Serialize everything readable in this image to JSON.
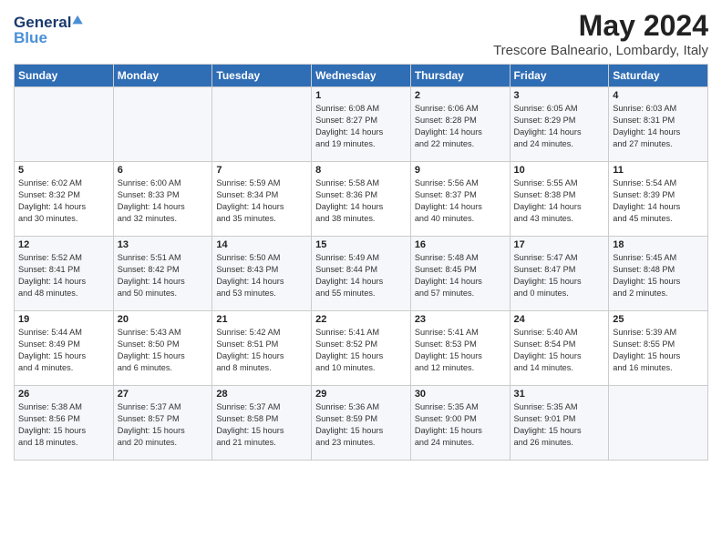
{
  "header": {
    "logo_general": "General",
    "logo_blue": "Blue",
    "title": "May 2024",
    "subtitle": "Trescore Balneario, Lombardy, Italy"
  },
  "calendar": {
    "days_of_week": [
      "Sunday",
      "Monday",
      "Tuesday",
      "Wednesday",
      "Thursday",
      "Friday",
      "Saturday"
    ],
    "weeks": [
      [
        {
          "day": "",
          "info": ""
        },
        {
          "day": "",
          "info": ""
        },
        {
          "day": "",
          "info": ""
        },
        {
          "day": "1",
          "info": "Sunrise: 6:08 AM\nSunset: 8:27 PM\nDaylight: 14 hours\nand 19 minutes."
        },
        {
          "day": "2",
          "info": "Sunrise: 6:06 AM\nSunset: 8:28 PM\nDaylight: 14 hours\nand 22 minutes."
        },
        {
          "day": "3",
          "info": "Sunrise: 6:05 AM\nSunset: 8:29 PM\nDaylight: 14 hours\nand 24 minutes."
        },
        {
          "day": "4",
          "info": "Sunrise: 6:03 AM\nSunset: 8:31 PM\nDaylight: 14 hours\nand 27 minutes."
        }
      ],
      [
        {
          "day": "5",
          "info": "Sunrise: 6:02 AM\nSunset: 8:32 PM\nDaylight: 14 hours\nand 30 minutes."
        },
        {
          "day": "6",
          "info": "Sunrise: 6:00 AM\nSunset: 8:33 PM\nDaylight: 14 hours\nand 32 minutes."
        },
        {
          "day": "7",
          "info": "Sunrise: 5:59 AM\nSunset: 8:34 PM\nDaylight: 14 hours\nand 35 minutes."
        },
        {
          "day": "8",
          "info": "Sunrise: 5:58 AM\nSunset: 8:36 PM\nDaylight: 14 hours\nand 38 minutes."
        },
        {
          "day": "9",
          "info": "Sunrise: 5:56 AM\nSunset: 8:37 PM\nDaylight: 14 hours\nand 40 minutes."
        },
        {
          "day": "10",
          "info": "Sunrise: 5:55 AM\nSunset: 8:38 PM\nDaylight: 14 hours\nand 43 minutes."
        },
        {
          "day": "11",
          "info": "Sunrise: 5:54 AM\nSunset: 8:39 PM\nDaylight: 14 hours\nand 45 minutes."
        }
      ],
      [
        {
          "day": "12",
          "info": "Sunrise: 5:52 AM\nSunset: 8:41 PM\nDaylight: 14 hours\nand 48 minutes."
        },
        {
          "day": "13",
          "info": "Sunrise: 5:51 AM\nSunset: 8:42 PM\nDaylight: 14 hours\nand 50 minutes."
        },
        {
          "day": "14",
          "info": "Sunrise: 5:50 AM\nSunset: 8:43 PM\nDaylight: 14 hours\nand 53 minutes."
        },
        {
          "day": "15",
          "info": "Sunrise: 5:49 AM\nSunset: 8:44 PM\nDaylight: 14 hours\nand 55 minutes."
        },
        {
          "day": "16",
          "info": "Sunrise: 5:48 AM\nSunset: 8:45 PM\nDaylight: 14 hours\nand 57 minutes."
        },
        {
          "day": "17",
          "info": "Sunrise: 5:47 AM\nSunset: 8:47 PM\nDaylight: 15 hours\nand 0 minutes."
        },
        {
          "day": "18",
          "info": "Sunrise: 5:45 AM\nSunset: 8:48 PM\nDaylight: 15 hours\nand 2 minutes."
        }
      ],
      [
        {
          "day": "19",
          "info": "Sunrise: 5:44 AM\nSunset: 8:49 PM\nDaylight: 15 hours\nand 4 minutes."
        },
        {
          "day": "20",
          "info": "Sunrise: 5:43 AM\nSunset: 8:50 PM\nDaylight: 15 hours\nand 6 minutes."
        },
        {
          "day": "21",
          "info": "Sunrise: 5:42 AM\nSunset: 8:51 PM\nDaylight: 15 hours\nand 8 minutes."
        },
        {
          "day": "22",
          "info": "Sunrise: 5:41 AM\nSunset: 8:52 PM\nDaylight: 15 hours\nand 10 minutes."
        },
        {
          "day": "23",
          "info": "Sunrise: 5:41 AM\nSunset: 8:53 PM\nDaylight: 15 hours\nand 12 minutes."
        },
        {
          "day": "24",
          "info": "Sunrise: 5:40 AM\nSunset: 8:54 PM\nDaylight: 15 hours\nand 14 minutes."
        },
        {
          "day": "25",
          "info": "Sunrise: 5:39 AM\nSunset: 8:55 PM\nDaylight: 15 hours\nand 16 minutes."
        }
      ],
      [
        {
          "day": "26",
          "info": "Sunrise: 5:38 AM\nSunset: 8:56 PM\nDaylight: 15 hours\nand 18 minutes."
        },
        {
          "day": "27",
          "info": "Sunrise: 5:37 AM\nSunset: 8:57 PM\nDaylight: 15 hours\nand 20 minutes."
        },
        {
          "day": "28",
          "info": "Sunrise: 5:37 AM\nSunset: 8:58 PM\nDaylight: 15 hours\nand 21 minutes."
        },
        {
          "day": "29",
          "info": "Sunrise: 5:36 AM\nSunset: 8:59 PM\nDaylight: 15 hours\nand 23 minutes."
        },
        {
          "day": "30",
          "info": "Sunrise: 5:35 AM\nSunset: 9:00 PM\nDaylight: 15 hours\nand 24 minutes."
        },
        {
          "day": "31",
          "info": "Sunrise: 5:35 AM\nSunset: 9:01 PM\nDaylight: 15 hours\nand 26 minutes."
        },
        {
          "day": "",
          "info": ""
        }
      ]
    ]
  }
}
